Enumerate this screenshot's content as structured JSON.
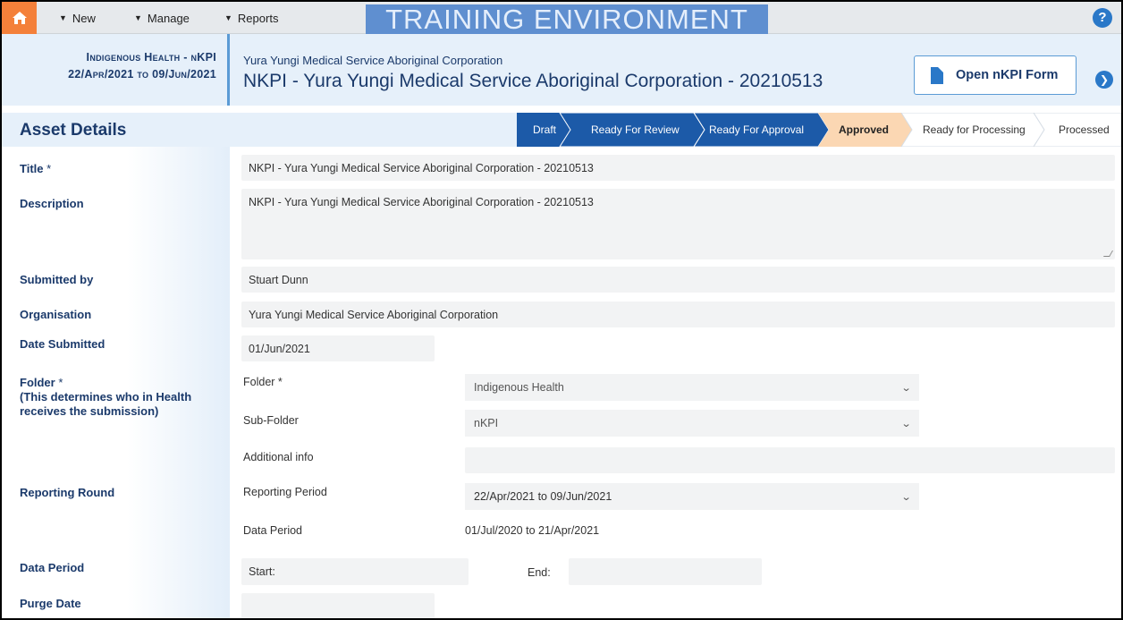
{
  "nav": {
    "new_label": "New",
    "manage_label": "Manage",
    "reports_label": "Reports",
    "banner": "TRAINING ENVIRONMENT",
    "help_glyph": "?"
  },
  "header": {
    "round_line1": "Indigenous Health - nKPI",
    "round_line2": "22/Apr/2021 to 09/Jun/2021",
    "org_name": "Yura Yungi Medical Service Aboriginal Corporation",
    "title": "NKPI - Yura Yungi Medical Service Aboriginal Corporation - 20210513",
    "open_form_label": "Open nKPI Form"
  },
  "asset": {
    "section_title": "Asset Details",
    "workflow": [
      {
        "label": "Draft",
        "state": "done"
      },
      {
        "label": "Ready For Review",
        "state": "done"
      },
      {
        "label": "Ready For Approval",
        "state": "done"
      },
      {
        "label": "Approved",
        "state": "current"
      },
      {
        "label": "Ready for Processing",
        "state": "todo"
      },
      {
        "label": "Processed",
        "state": "todo"
      }
    ]
  },
  "form": {
    "title_label": "Title",
    "title_value": "NKPI - Yura Yungi Medical Service Aboriginal Corporation - 20210513",
    "description_label": "Description",
    "description_value": "NKPI - Yura Yungi Medical Service Aboriginal Corporation - 20210513",
    "submitted_by_label": "Submitted by",
    "submitted_by_value": "Stuart Dunn",
    "organisation_label": "Organisation",
    "organisation_value": "Yura Yungi Medical Service Aboriginal Corporation",
    "date_submitted_label": "Date Submitted",
    "date_submitted_value": "01/Jun/2021",
    "folder_label": "Folder",
    "folder_note": "(This determines who in Health receives the submission)",
    "folder_sub_label": "Folder",
    "folder_value": "Indigenous Health",
    "subfolder_label": "Sub-Folder",
    "subfolder_value": "nKPI",
    "additional_info_label": "Additional info",
    "additional_info_value": "",
    "reporting_round_label": "Reporting Round",
    "reporting_period_label": "Reporting Period",
    "reporting_period_value": "22/Apr/2021 to 09/Jun/2021",
    "data_period_sub_label": "Data Period",
    "data_period_sub_value": "01/Jul/2020 to 21/Apr/2021",
    "data_period_label": "Data Period",
    "start_label": "Start:",
    "start_value": "",
    "end_label": "End:",
    "end_value": "",
    "purge_date_label": "Purge Date",
    "purge_date_value": "",
    "required_mark": "*"
  }
}
